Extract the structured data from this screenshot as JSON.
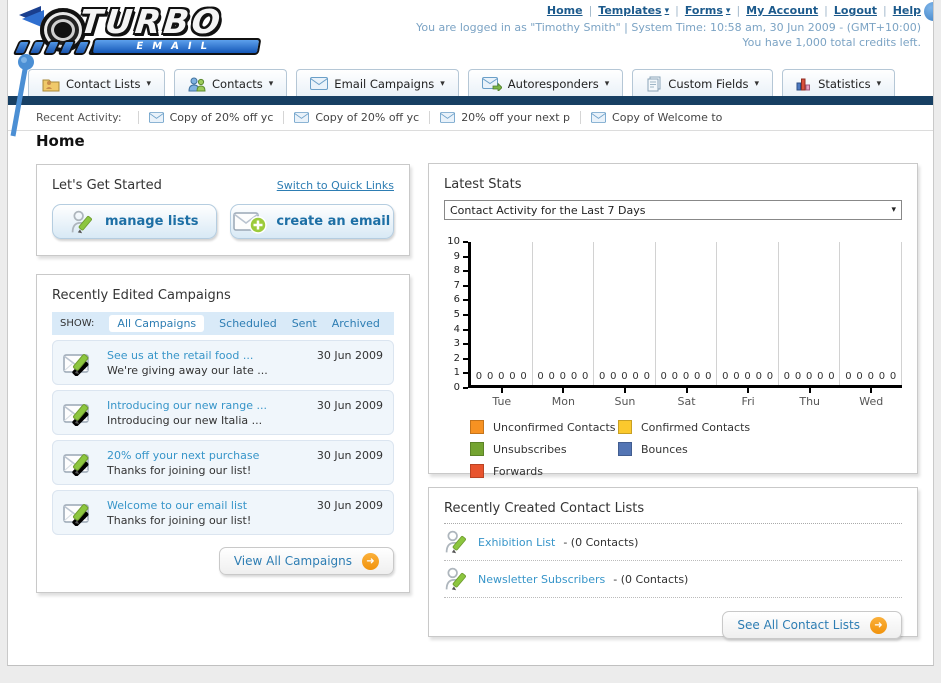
{
  "icons": {
    "dropdown_arrow": "▾",
    "arrow_right": "➜"
  },
  "header": {
    "logo_line1": "TURBO",
    "logo_line2": "EMAIL",
    "nav_links": [
      {
        "label": "Home",
        "dropdown": false
      },
      {
        "label": "Templates",
        "dropdown": true
      },
      {
        "label": "Forms",
        "dropdown": true
      },
      {
        "label": "My Account",
        "dropdown": false
      },
      {
        "label": "Logout",
        "dropdown": false
      },
      {
        "label": "Help",
        "dropdown": false
      }
    ],
    "login_line": "You are logged in as \"Timothy Smith\" | System Time: 10:58 am, 30 Jun 2009 - (GMT+10:00)",
    "credits_line": "You have 1,000 total credits left."
  },
  "nav_tabs": [
    {
      "label": "Contact Lists"
    },
    {
      "label": "Contacts"
    },
    {
      "label": "Email Campaigns"
    },
    {
      "label": "Autoresponders"
    },
    {
      "label": "Custom Fields"
    },
    {
      "label": "Statistics"
    }
  ],
  "recent_activity": {
    "label": "Recent Activity:",
    "items": [
      "Copy of 20% off yc",
      "Copy of 20% off yc",
      "20% off your next p",
      "Copy of Welcome to"
    ]
  },
  "page_title": "Home",
  "get_started": {
    "title": "Let's Get Started",
    "switch_link": "Switch to Quick Links",
    "buttons": [
      {
        "label": "manage lists"
      },
      {
        "label": "create an email"
      }
    ]
  },
  "campaigns": {
    "title": "Recently Edited Campaigns",
    "show_label": "SHOW:",
    "filters": [
      "All Campaigns",
      "Scheduled",
      "Sent",
      "Archived"
    ],
    "active_filter": "All Campaigns",
    "items": [
      {
        "title": "See us at the retail food ...",
        "subtitle": "We're giving away our late ...",
        "date": "30 Jun 2009"
      },
      {
        "title": "Introducing our new range ...",
        "subtitle": "Introducing our new Italia ...",
        "date": "30 Jun 2009"
      },
      {
        "title": "20% off your next purchase",
        "subtitle": "Thanks for joining our list!",
        "date": "30 Jun 2009"
      },
      {
        "title": "Welcome to our email list",
        "subtitle": "Thanks for joining our list!",
        "date": "30 Jun 2009"
      }
    ],
    "view_all_label": "View All Campaigns"
  },
  "latest_stats": {
    "title": "Latest Stats",
    "dropdown_value": "Contact Activity for the Last 7 Days"
  },
  "chart_data": {
    "type": "bar",
    "title": "Contact Activity for the Last 7 Days",
    "categories": [
      "Tue",
      "Mon",
      "Sun",
      "Sat",
      "Fri",
      "Thu",
      "Wed"
    ],
    "series": [
      {
        "name": "Unconfirmed Contacts",
        "color": "#f79222",
        "values": [
          0,
          0,
          0,
          0,
          0,
          0,
          0
        ]
      },
      {
        "name": "Confirmed Contacts",
        "color": "#fbc92d",
        "values": [
          0,
          0,
          0,
          0,
          0,
          0,
          0
        ]
      },
      {
        "name": "Unsubscribes",
        "color": "#74a431",
        "values": [
          0,
          0,
          0,
          0,
          0,
          0,
          0
        ]
      },
      {
        "name": "Bounces",
        "color": "#5375b4",
        "values": [
          0,
          0,
          0,
          0,
          0,
          0,
          0
        ]
      },
      {
        "name": "Forwards",
        "color": "#e8542e",
        "values": [
          0,
          0,
          0,
          0,
          0,
          0,
          0
        ]
      }
    ],
    "ylim": [
      0,
      10
    ],
    "ytick_step": 1,
    "value_labels_shown": true,
    "grid": "vertical",
    "legend_position": "bottom"
  },
  "contact_lists": {
    "title": "Recently Created Contact Lists",
    "items": [
      {
        "name": "Exhibition List",
        "suffix": " - (0 Contacts)"
      },
      {
        "name": "Newsletter Subscribers",
        "suffix": " - (0 Contacts)"
      }
    ],
    "see_all_label": "See All Contact Lists"
  }
}
